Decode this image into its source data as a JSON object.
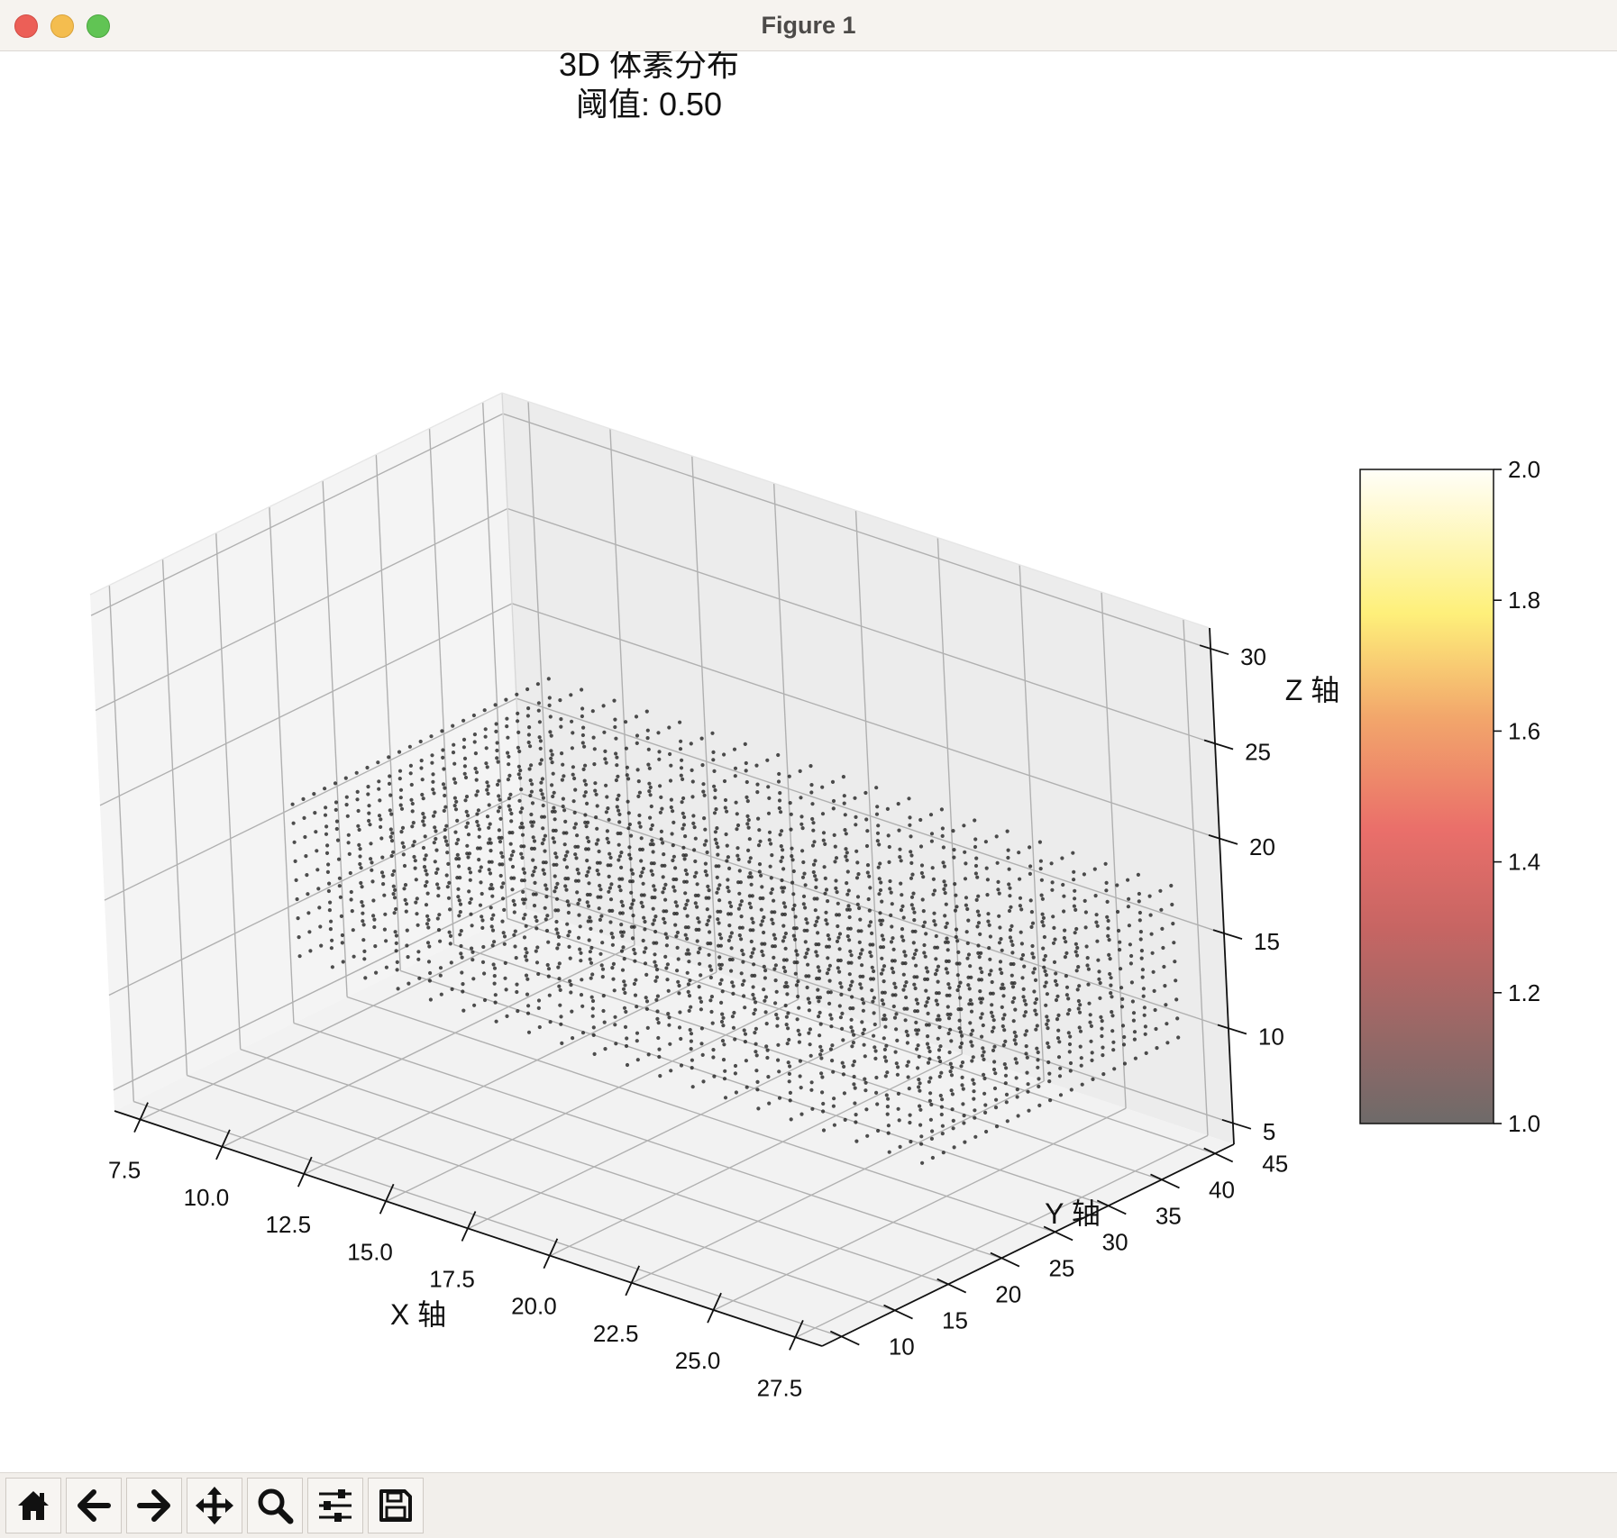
{
  "window": {
    "title": "Figure 1"
  },
  "figure": {
    "title_line1": "3D 体素分布",
    "title_line2": "阈值: 0.50"
  },
  "colors": {
    "window_bg": "#f6f3ef",
    "pane": "#f2f2f2",
    "grid": "#b0b0b0",
    "voxel": "#222222"
  },
  "toolbar": {
    "buttons": [
      {
        "name": "home-button",
        "icon": "home-icon"
      },
      {
        "name": "back-button",
        "icon": "arrow-left-icon"
      },
      {
        "name": "forward-button",
        "icon": "arrow-right-icon"
      },
      {
        "name": "pan-button",
        "icon": "move-icon"
      },
      {
        "name": "zoom-button",
        "icon": "magnifier-icon"
      },
      {
        "name": "configure-subplots-button",
        "icon": "sliders-icon"
      },
      {
        "name": "save-button",
        "icon": "floppy-disk-icon"
      }
    ]
  },
  "chart_data": {
    "type": "scatter",
    "projection": "3d",
    "title": "3D 体素分布\n阈值: 0.50",
    "xlabel": "X 轴",
    "ylabel": "Y 轴",
    "zlabel": "Z 轴",
    "x_ticks": [
      "7.5",
      "10.0",
      "12.5",
      "15.0",
      "17.5",
      "20.0",
      "22.5",
      "25.0",
      "27.5"
    ],
    "y_ticks": [
      "10",
      "15",
      "20",
      "25",
      "30",
      "35",
      "40",
      "45"
    ],
    "z_ticks": [
      "5",
      "10",
      "15",
      "20",
      "25",
      "30"
    ],
    "xlim": [
      6.7,
      28.3
    ],
    "ylim": [
      8.2,
      46.8
    ],
    "zlim": [
      3.9,
      31.1
    ],
    "grid": true,
    "voxels": {
      "x_range": [
        8,
        27
      ],
      "y_range": [
        22,
        46
      ],
      "z_range": [
        9,
        17
      ],
      "step": 1,
      "color": "#222222",
      "alpha": 0.8
    },
    "colorbar": {
      "ticks": [
        "1.0",
        "1.2",
        "1.4",
        "1.6",
        "1.8",
        "2.0"
      ],
      "range": [
        1.0,
        2.0
      ],
      "colormap": "hot",
      "alpha": 0.6
    }
  }
}
